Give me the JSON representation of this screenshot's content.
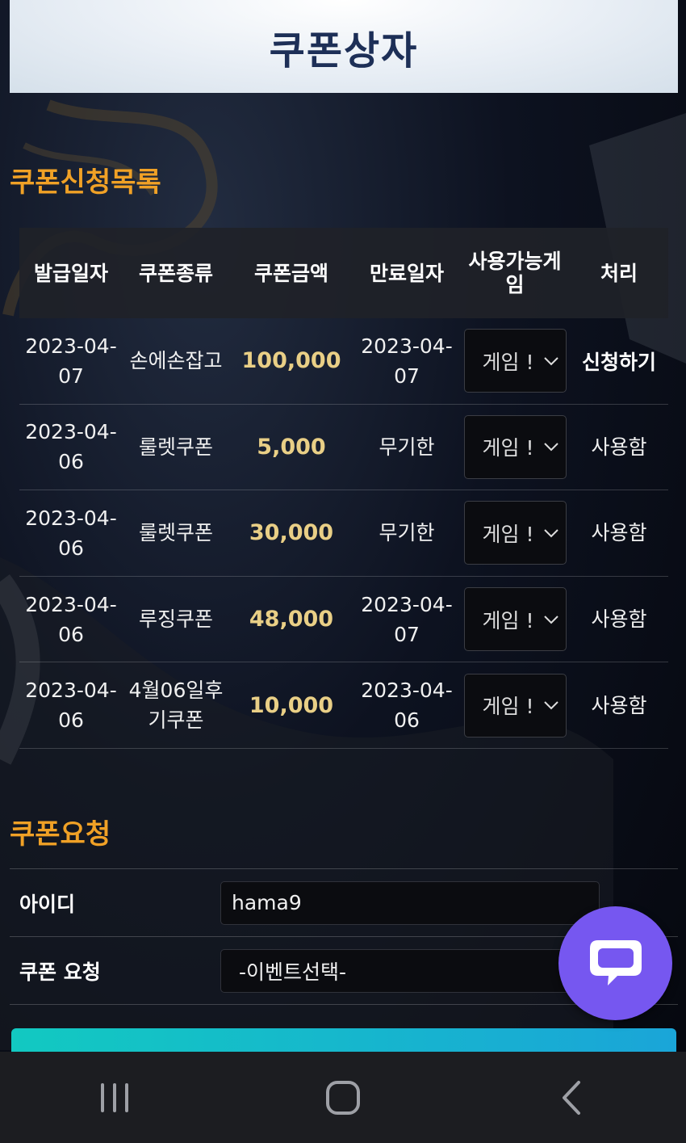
{
  "header": {
    "title": "쿠폰상자"
  },
  "coupon_list": {
    "title": "쿠폰신청목록",
    "columns": [
      "발급일자",
      "쿠폰종류",
      "쿠폰금액",
      "만료일자",
      "사용가능게임",
      "처리"
    ],
    "rows": [
      {
        "issue_date": "2023-04-07",
        "type": "손에손잡고",
        "amount": "100,000",
        "expire": "2023-04-07",
        "game": "게임 !",
        "action": "신청하기"
      },
      {
        "issue_date": "2023-04-06",
        "type": "룰렛쿠폰",
        "amount": "5,000",
        "expire": "무기한",
        "game": "게임 !",
        "action": "사용함"
      },
      {
        "issue_date": "2023-04-06",
        "type": "룰렛쿠폰",
        "amount": "30,000",
        "expire": "무기한",
        "game": "게임 !",
        "action": "사용함"
      },
      {
        "issue_date": "2023-04-06",
        "type": "루징쿠폰",
        "amount": "48,000",
        "expire": "2023-04-07",
        "game": "게임 !",
        "action": "사용함"
      },
      {
        "issue_date": "2023-04-06",
        "type": "4월06일후기쿠폰",
        "amount": "10,000",
        "expire": "2023-04-06",
        "game": "게임 !",
        "action": "사용함"
      }
    ]
  },
  "request": {
    "title": "쿠폰요청",
    "id_label": "아이디",
    "id_value": "hama9",
    "coupon_label": "쿠폰 요청",
    "coupon_select": "-이벤트선택-"
  },
  "colors": {
    "accent": "#f0a126",
    "amount": "#e9cf86",
    "chat": "#7657f0",
    "submit": "#12c9c1"
  },
  "icons": [
    "chat-icon",
    "recent-apps-icon",
    "home-icon",
    "back-icon",
    "chevron-down-icon"
  ]
}
